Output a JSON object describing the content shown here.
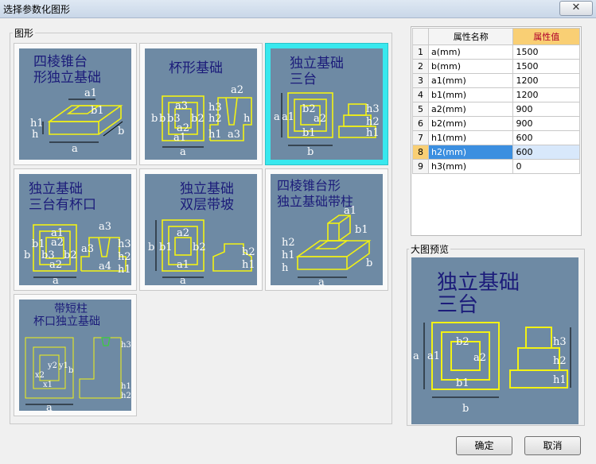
{
  "window": {
    "title": "选择参数化图形",
    "close_icon": "close-icon"
  },
  "shapes_group": {
    "label": "图形",
    "items": [
      {
        "caption_lines": [
          "四棱锥台",
          "形独立基础"
        ],
        "labels": [
          "a1",
          "b1",
          "h1",
          "h",
          "a",
          "b"
        ]
      },
      {
        "caption_lines": [
          "杯形基础"
        ],
        "labels": [
          "a2",
          "a3",
          "b",
          "b",
          "b3",
          "b2",
          "a2",
          "a1",
          "a",
          "h3",
          "h2",
          "h1",
          "h",
          "a3"
        ]
      },
      {
        "caption_lines": [
          "独立基础",
          "三台"
        ],
        "labels": [
          "b2",
          "a2",
          "a",
          "a1",
          "b1",
          "b",
          "h3",
          "h2",
          "h1"
        ],
        "selected": true
      },
      {
        "caption_lines": [
          "独立基础",
          "三台有杯口"
        ],
        "labels": [
          "a1",
          "a2",
          "b1",
          "a3",
          "b",
          "b3",
          "b2",
          "a2",
          "a",
          "a3",
          "h3",
          "h2",
          "h1",
          "a4"
        ]
      },
      {
        "caption_lines": [
          "独立基础",
          "双层带坡"
        ],
        "labels": [
          "a2",
          "b",
          "b1",
          "b2",
          "a1",
          "a",
          "h2",
          "h1"
        ]
      },
      {
        "caption_lines": [
          "四棱锥台形",
          "独立基础带柱"
        ],
        "labels": [
          "a1",
          "b1",
          "h2",
          "h1",
          "h",
          "a",
          "b"
        ]
      },
      {
        "caption_lines": [
          "带短柱",
          "杯口独立基础"
        ],
        "labels": [
          "y2",
          "x2",
          "x1",
          "y1",
          "b",
          "a",
          "h3",
          "h1",
          "h2"
        ]
      }
    ]
  },
  "properties": {
    "header_name": "属性名称",
    "header_value": "属性值",
    "rows": [
      {
        "index": "1",
        "name": "a(mm)",
        "value": "1500"
      },
      {
        "index": "2",
        "name": "b(mm)",
        "value": "1500"
      },
      {
        "index": "3",
        "name": "a1(mm)",
        "value": "1200"
      },
      {
        "index": "4",
        "name": "b1(mm)",
        "value": "1200"
      },
      {
        "index": "5",
        "name": "a2(mm)",
        "value": "900"
      },
      {
        "index": "6",
        "name": "b2(mm)",
        "value": "900"
      },
      {
        "index": "7",
        "name": "h1(mm)",
        "value": "600"
      },
      {
        "index": "8",
        "name": "h2(mm)",
        "value": "600"
      },
      {
        "index": "9",
        "name": "h3(mm)",
        "value": "0"
      }
    ],
    "selected_row": "8"
  },
  "preview": {
    "label": "大图预览",
    "caption_lines": [
      "独立基础",
      "三台"
    ],
    "labels": [
      "b2",
      "a2",
      "a",
      "a1",
      "b1",
      "b",
      "h3",
      "h2",
      "h1"
    ]
  },
  "buttons": {
    "ok": "确定",
    "cancel": "取消"
  },
  "colors": {
    "thumb_bg": "#6e8aa4",
    "drawing_line": "#f2f214",
    "selected_frame": "#38e8ee",
    "caption": "#1c1c7a",
    "header_highlight": "#f9cf74"
  }
}
